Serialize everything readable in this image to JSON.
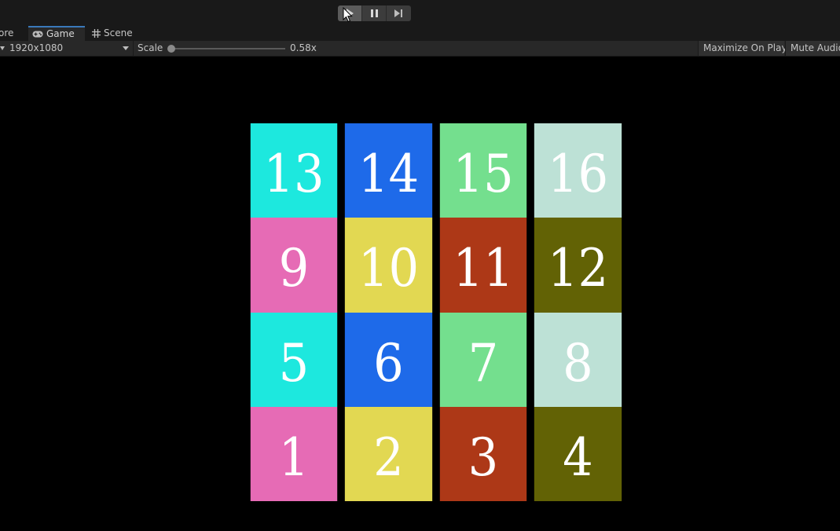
{
  "tabs": {
    "partial_label": "ore",
    "game_label": "Game",
    "scene_label": "Scene"
  },
  "game_toolbar": {
    "resolution": "1920x1080",
    "scale_label": "Scale",
    "scale_value": "0.58x",
    "scale_fraction": 0.0,
    "maximize_label": "Maximize On Play",
    "mute_label": "Mute Audio"
  },
  "colors": {
    "cyan": "#1de8de",
    "blue": "#1e6ae9",
    "green": "#74df8e",
    "mint": "#bde1d6",
    "pink": "#e66bb5",
    "yellow": "#e2d852",
    "rust": "#ad3817",
    "olive": "#626205",
    "accent": "#3a79bb"
  },
  "tiles": [
    {
      "label": "13",
      "color": "#1de8de"
    },
    {
      "label": "14",
      "color": "#1e6ae9"
    },
    {
      "label": "15",
      "color": "#74df8e"
    },
    {
      "label": "16",
      "color": "#bde1d6"
    },
    {
      "label": "9",
      "color": "#e66bb5"
    },
    {
      "label": "10",
      "color": "#e2d852"
    },
    {
      "label": "11",
      "color": "#ad3817"
    },
    {
      "label": "12",
      "color": "#626205"
    },
    {
      "label": "5",
      "color": "#1de8de"
    },
    {
      "label": "6",
      "color": "#1e6ae9"
    },
    {
      "label": "7",
      "color": "#74df8e"
    },
    {
      "label": "8",
      "color": "#bde1d6"
    },
    {
      "label": "1",
      "color": "#e66bb5"
    },
    {
      "label": "2",
      "color": "#e2d852"
    },
    {
      "label": "3",
      "color": "#ad3817"
    },
    {
      "label": "4",
      "color": "#626205"
    }
  ],
  "icons": {
    "play": "play-icon",
    "pause": "pause-icon",
    "step": "step-icon",
    "game_tab": "gamepad-icon",
    "scene_tab": "grid-icon"
  }
}
